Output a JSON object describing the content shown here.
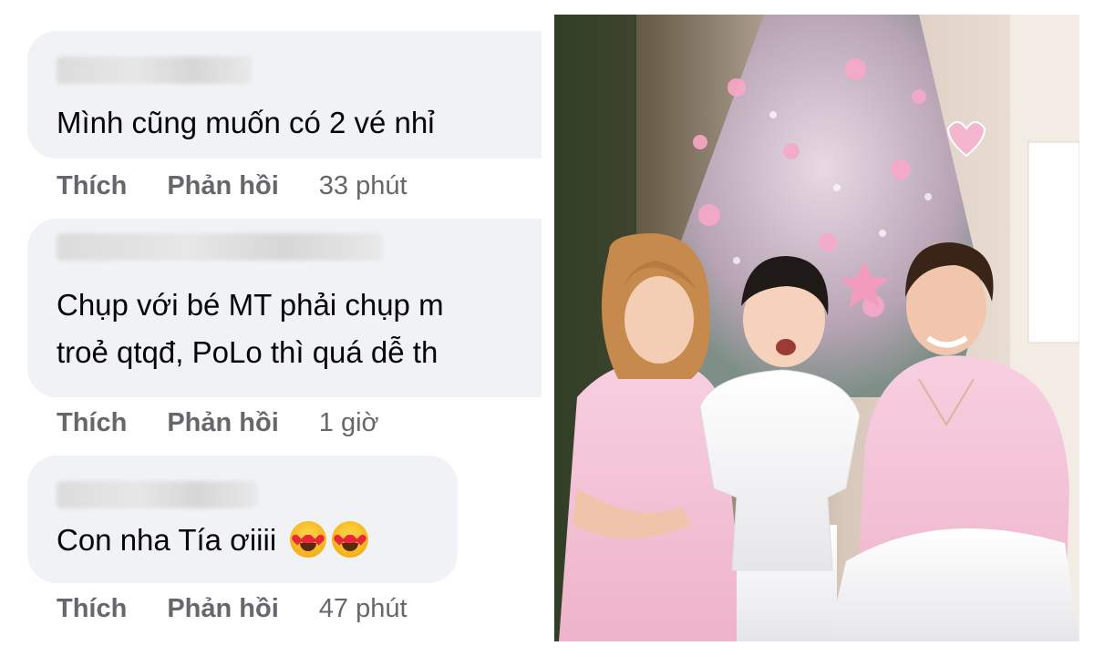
{
  "comments": [
    {
      "text": "Mình cũng muốn có 2 vé nhỉ",
      "like_label": "Thích",
      "reply_label": "Phản hồi",
      "time": "33 phút"
    },
    {
      "text_line1": "Chụp với bé MT phải chụp m",
      "text_line2": "troẻ qtqđ, PoLo thì quá dễ th",
      "like_label": "Thích",
      "reply_label": "Phản hồi",
      "time": "1 giờ"
    },
    {
      "text": "Con nha Tía ơiiii",
      "emoji": "heart-eyes-face",
      "like_label": "Thích",
      "reply_label": "Phản hồi",
      "time": "47 phút"
    }
  ],
  "photo": {
    "subject": "family-photo-christmas-tree",
    "palette": {
      "tree": "#d9c6d6",
      "shirt_pink": "#f4c6d8",
      "pants_white": "#f2f2f2",
      "wall": "#e8ddd2"
    }
  }
}
